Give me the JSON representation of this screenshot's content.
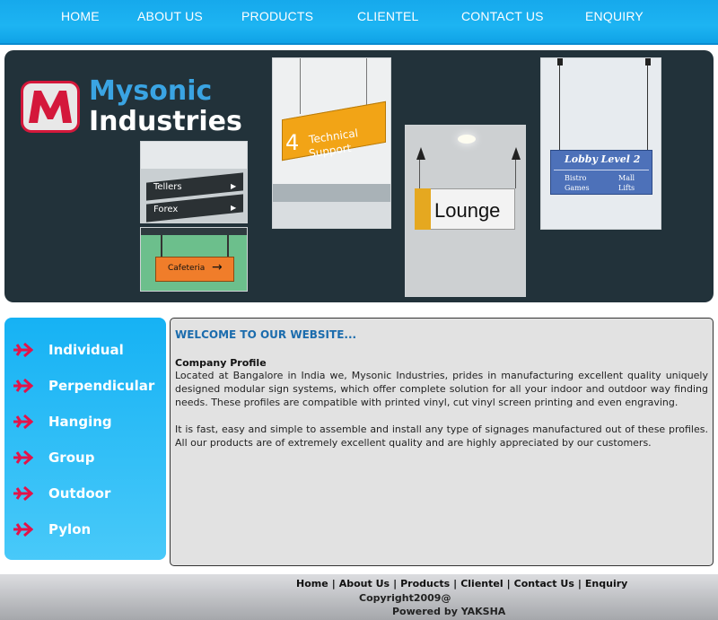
{
  "nav": {
    "items": [
      "HOME",
      "ABOUT US",
      "PRODUCTS",
      "CLIENTEL",
      "CONTACT US",
      "ENQUIRY"
    ]
  },
  "banner": {
    "brand_line1": "Mysonic",
    "brand_line2": "Industries",
    "signs": {
      "tellers": "Tellers",
      "forex": "Forex",
      "cafeteria": "Cafeteria",
      "tech_number": "4",
      "tech_line1": "Technical",
      "tech_line2": "Support",
      "lounge": "Lounge",
      "lobby_title": "Lobby Level 2",
      "lobby_items": [
        "Bistro",
        "Mall",
        "Games",
        "Lifts"
      ]
    }
  },
  "sidebar": {
    "items": [
      "Individual",
      "Perpendicular",
      "Hanging",
      "Group",
      "Outdoor",
      "Pylon"
    ]
  },
  "content": {
    "welcome": "WELCOME TO OUR WEBSITE...",
    "profile_heading": "Company Profile",
    "paragraphs": [
      "Located at Bangalore in India we, Mysonic Industries, prides in manufacturing excellent quality uniquely designed modular sign systems, which offer complete solution for all your indoor and outdoor way finding needs. These profiles are compatible with printed vinyl, cut vinyl screen printing and even engraving.",
      "It is fast, easy and simple to assemble and install any type of signages manufactured out of these profiles. All our products are of extremely excellent quality and are highly appreciated by our customers."
    ]
  },
  "footer": {
    "links": [
      "Home",
      "About Us",
      "Products",
      "Clientel",
      "Contact Us",
      "Enquiry"
    ],
    "separator": "|",
    "copyright": "Copyright2009@",
    "powered_prefix": "Powered by",
    "powered_name": "YAKSHA"
  },
  "colors": {
    "nav_bg": "#1db4f2",
    "banner_bg": "#22323a",
    "accent_red": "#d4183b",
    "heading_blue": "#1b6cad"
  }
}
